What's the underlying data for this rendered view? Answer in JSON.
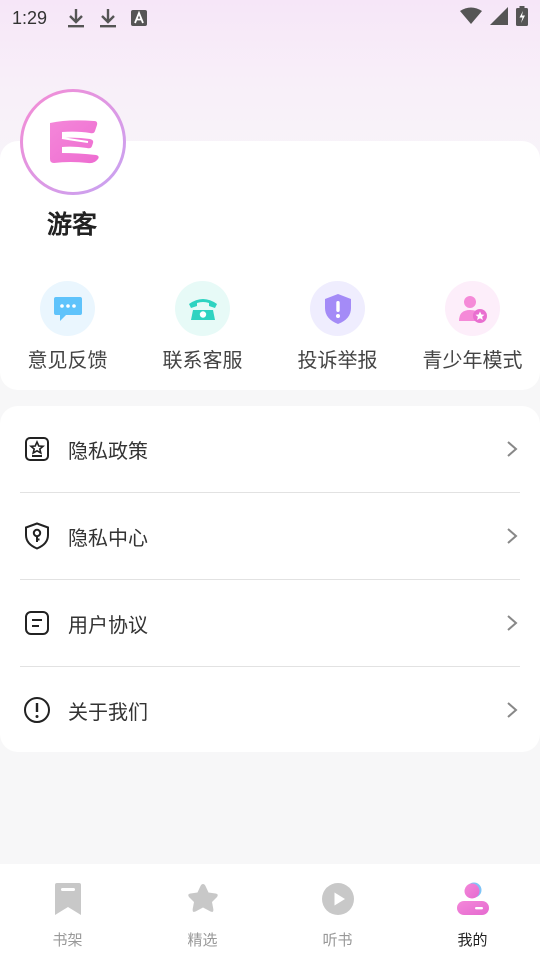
{
  "status_bar": {
    "time": "1:29",
    "left_icons": [
      "download-icon",
      "download-icon",
      "text-a-icon"
    ],
    "right_icons": [
      "wifi-icon",
      "signal-icon",
      "battery-icon"
    ]
  },
  "profile": {
    "username": "游客"
  },
  "quick_actions": [
    {
      "label": "意见反馈",
      "icon": "chat-bubble-icon",
      "color": "#6cc7ff"
    },
    {
      "label": "联系客服",
      "icon": "telephone-icon",
      "color": "#35d5c4"
    },
    {
      "label": "投诉举报",
      "icon": "shield-alert-icon",
      "color": "#a58cf6"
    },
    {
      "label": "青少年模式",
      "icon": "teen-user-icon",
      "color": "#f58ad8"
    }
  ],
  "menu": [
    {
      "label": "隐私政策",
      "icon": "privacy-policy-icon"
    },
    {
      "label": "隐私中心",
      "icon": "shield-key-icon"
    },
    {
      "label": "用户协议",
      "icon": "agreement-icon"
    },
    {
      "label": "关于我们",
      "icon": "info-alert-icon"
    }
  ],
  "bottom_nav": [
    {
      "label": "书架",
      "icon": "bookmark-icon",
      "active": false
    },
    {
      "label": "精选",
      "icon": "star-icon",
      "active": false
    },
    {
      "label": "听书",
      "icon": "play-icon",
      "active": false
    },
    {
      "label": "我的",
      "icon": "profile-icon",
      "active": true
    }
  ],
  "colors": {
    "accent": "#f07ad5",
    "inactive_icon": "#c8c8c8",
    "background": "#f7f7f8"
  }
}
